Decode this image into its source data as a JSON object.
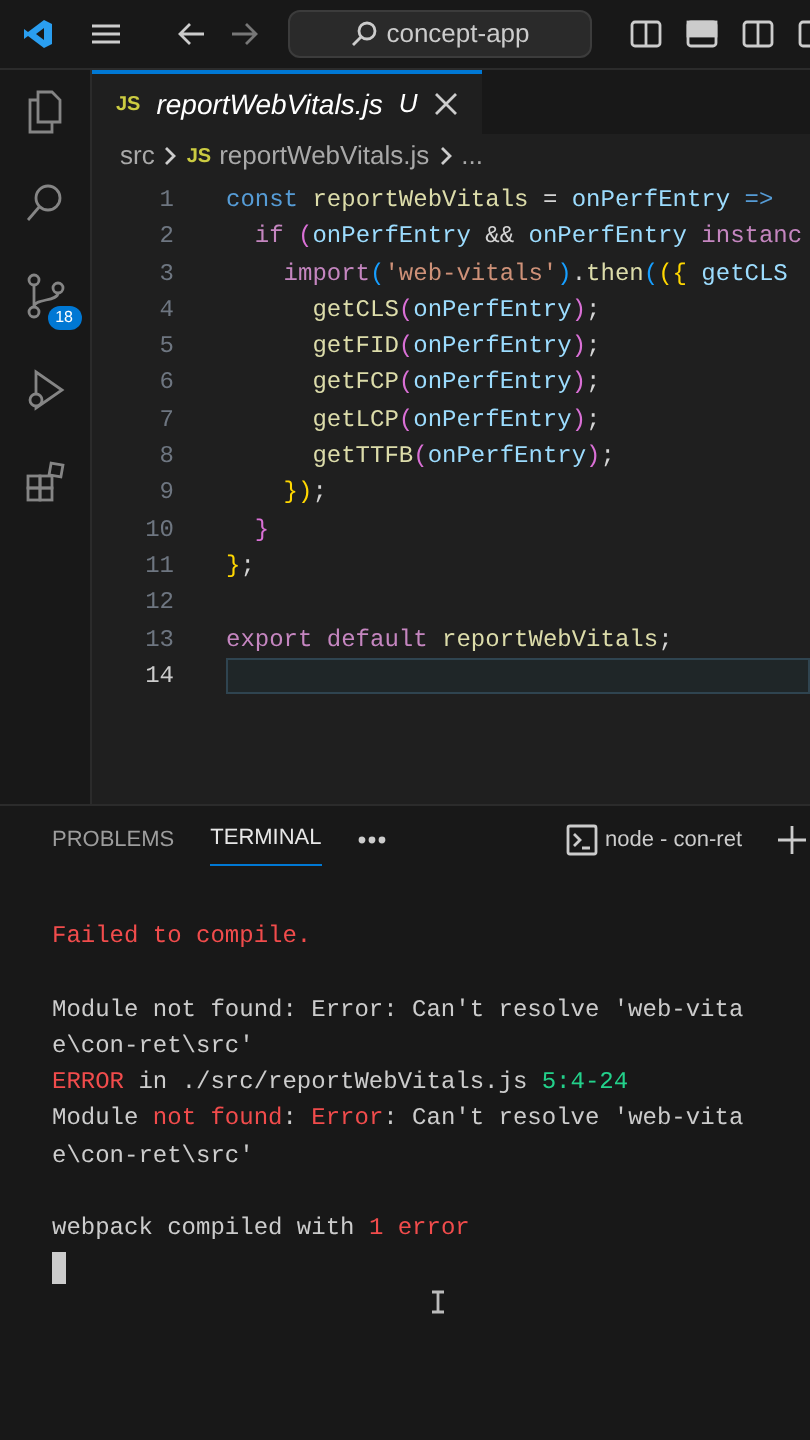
{
  "title_bar": {
    "search": "concept-app"
  },
  "activity_bar": {
    "items": [
      {
        "kind": "files"
      },
      {
        "kind": "search"
      },
      {
        "kind": "source-control",
        "badge": "18"
      },
      {
        "kind": "run"
      },
      {
        "kind": "extensions"
      }
    ]
  },
  "tab": {
    "badge": "JS",
    "label": "reportWebVitals.js",
    "status": "U"
  },
  "breadcrumb": [
    {
      "text": "src"
    },
    {
      "badge": "JS",
      "text": "reportWebVitals.js"
    },
    {
      "text": "..."
    }
  ],
  "editor": {
    "lines": [
      {
        "number": "1",
        "current": false,
        "tokens": [
          {
            "kind": "keyword",
            "text": "const "
          },
          {
            "kind": "function",
            "text": "reportWebVitals"
          },
          {
            "kind": "punct",
            "text": " = "
          },
          {
            "kind": "variable",
            "text": "onPerfEntry"
          },
          {
            "kind": "keyword",
            "text": " =>"
          }
        ]
      },
      {
        "number": "2",
        "current": false,
        "tokens": [
          {
            "kind": "control",
            "text": "  if "
          },
          {
            "kind": "bracket2",
            "text": "("
          },
          {
            "kind": "variable",
            "text": "onPerfEntry"
          },
          {
            "kind": "punct",
            "text": " && "
          },
          {
            "kind": "variable",
            "text": "onPerfEntry"
          },
          {
            "kind": "control",
            "text": " instanc"
          }
        ]
      },
      {
        "number": "3",
        "current": false,
        "tokens": [
          {
            "kind": "control",
            "text": "    import"
          },
          {
            "kind": "bracket3",
            "text": "("
          },
          {
            "kind": "string",
            "text": "'web-vitals'"
          },
          {
            "kind": "bracket3",
            "text": ")"
          },
          {
            "kind": "punct",
            "text": "."
          },
          {
            "kind": "function",
            "text": "then"
          },
          {
            "kind": "bracket3",
            "text": "("
          },
          {
            "kind": "bracket1",
            "text": "({"
          },
          {
            "kind": "variable",
            "text": " getCLS"
          }
        ]
      },
      {
        "number": "4",
        "current": false,
        "tokens": [
          {
            "kind": "function",
            "text": "      getCLS"
          },
          {
            "kind": "bracket2",
            "text": "("
          },
          {
            "kind": "variable",
            "text": "onPerfEntry"
          },
          {
            "kind": "bracket2",
            "text": ")"
          },
          {
            "kind": "punct",
            "text": ";"
          }
        ]
      },
      {
        "number": "5",
        "current": false,
        "tokens": [
          {
            "kind": "function",
            "text": "      getFID"
          },
          {
            "kind": "bracket2",
            "text": "("
          },
          {
            "kind": "variable",
            "text": "onPerfEntry"
          },
          {
            "kind": "bracket2",
            "text": ")"
          },
          {
            "kind": "punct",
            "text": ";"
          }
        ]
      },
      {
        "number": "6",
        "current": false,
        "tokens": [
          {
            "kind": "function",
            "text": "      getFCP"
          },
          {
            "kind": "bracket2",
            "text": "("
          },
          {
            "kind": "variable",
            "text": "onPerfEntry"
          },
          {
            "kind": "bracket2",
            "text": ")"
          },
          {
            "kind": "punct",
            "text": ";"
          }
        ]
      },
      {
        "number": "7",
        "current": false,
        "tokens": [
          {
            "kind": "function",
            "text": "      getLCP"
          },
          {
            "kind": "bracket2",
            "text": "("
          },
          {
            "kind": "variable",
            "text": "onPerfEntry"
          },
          {
            "kind": "bracket2",
            "text": ")"
          },
          {
            "kind": "punct",
            "text": ";"
          }
        ]
      },
      {
        "number": "8",
        "current": false,
        "tokens": [
          {
            "kind": "function",
            "text": "      getTTFB"
          },
          {
            "kind": "bracket2",
            "text": "("
          },
          {
            "kind": "variable",
            "text": "onPerfEntry"
          },
          {
            "kind": "bracket2",
            "text": ")"
          },
          {
            "kind": "punct",
            "text": ";"
          }
        ]
      },
      {
        "number": "9",
        "current": false,
        "tokens": [
          {
            "kind": "bracket1",
            "text": "    })"
          },
          {
            "kind": "punct",
            "text": ";"
          }
        ]
      },
      {
        "number": "10",
        "current": false,
        "tokens": [
          {
            "kind": "bracket2",
            "text": "  }"
          }
        ]
      },
      {
        "number": "11",
        "current": false,
        "tokens": [
          {
            "kind": "bracket1",
            "text": "}"
          },
          {
            "kind": "punct",
            "text": ";"
          }
        ]
      },
      {
        "number": "12",
        "current": false
      },
      {
        "number": "13",
        "current": false,
        "tokens": [
          {
            "kind": "control",
            "text": "export default "
          },
          {
            "kind": "function",
            "text": "reportWebVitals"
          },
          {
            "kind": "punct",
            "text": ";"
          }
        ]
      },
      {
        "number": "14",
        "current": true
      }
    ]
  },
  "panel": {
    "tabs": [
      {
        "label": "PROBLEMS",
        "selected": false
      },
      {
        "label": "TERMINAL",
        "selected": true
      }
    ],
    "terminal_name": "node - con-ret"
  },
  "terminal": {
    "blocks": [
      {
        "lines": [
          [
            {
              "kind": "error",
              "text": "Failed to compile."
            }
          ]
        ]
      },
      {
        "lines": [
          [
            {
              "kind": "plain",
              "text": "Module not found: Error: Can't resolve 'web-vita"
            }
          ],
          [
            {
              "kind": "plain",
              "text": "e\\con-ret\\src'"
            }
          ],
          [
            {
              "kind": "error",
              "text": "ERROR"
            },
            {
              "kind": "plain",
              "text": " in ./src/reportWebVitals.js "
            },
            {
              "kind": "success",
              "text": "5:4-24"
            }
          ],
          [
            {
              "kind": "plain",
              "text": "Module "
            },
            {
              "kind": "error",
              "text": "not found"
            },
            {
              "kind": "plain",
              "text": ": "
            },
            {
              "kind": "error",
              "text": "Error"
            },
            {
              "kind": "plain",
              "text": ": Can't resolve 'web-vita"
            }
          ],
          [
            {
              "kind": "plain",
              "text": "e\\con-ret\\src'"
            }
          ]
        ]
      },
      {
        "lines": [
          [
            {
              "kind": "plain",
              "text": "webpack compiled with "
            },
            {
              "kind": "error",
              "text": "1 error"
            }
          ]
        ]
      }
    ]
  }
}
